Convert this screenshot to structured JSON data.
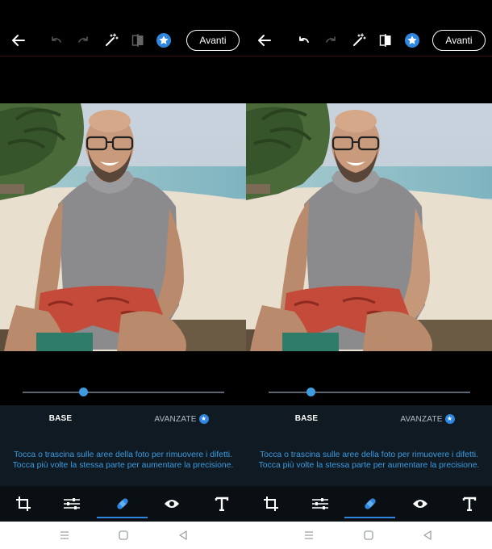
{
  "panels": [
    {
      "toolbar": {
        "avanti_label": "Avanti"
      },
      "tabs": {
        "base": "BASE",
        "avanzate": "AVANZATE"
      },
      "hint_line1": "Tocca o trascina sulle aree della foto per rimuovere i difetti.",
      "hint_line2": "Tocca più volte la stessa parte per aumentare la precisione.",
      "slider_value": 0.3,
      "undo_enabled": false
    },
    {
      "toolbar": {
        "avanti_label": "Avanti"
      },
      "tabs": {
        "base": "BASE",
        "avanzate": "AVANZATE"
      },
      "hint_line1": "Tocca o trascina sulle aree della foto per rimuovere i difetti.",
      "hint_line2": "Tocca più volte la stessa parte per aumentare la precisione.",
      "slider_value": 0.21,
      "undo_enabled": true
    }
  ],
  "icons": {
    "toolbar": [
      "back-arrow-icon",
      "undo-icon",
      "redo-icon",
      "magic-wand-icon",
      "compare-icon",
      "premium-star-icon"
    ],
    "tools": [
      "crop-icon",
      "adjustments-icon",
      "healing-icon",
      "eye-icon",
      "text-icon"
    ],
    "nav": [
      "recent-apps-icon",
      "home-icon",
      "back-icon"
    ]
  },
  "colors": {
    "accent": "#3d9be0",
    "panel_bg": "#0f1a22",
    "active_tool": "#2e86de"
  }
}
